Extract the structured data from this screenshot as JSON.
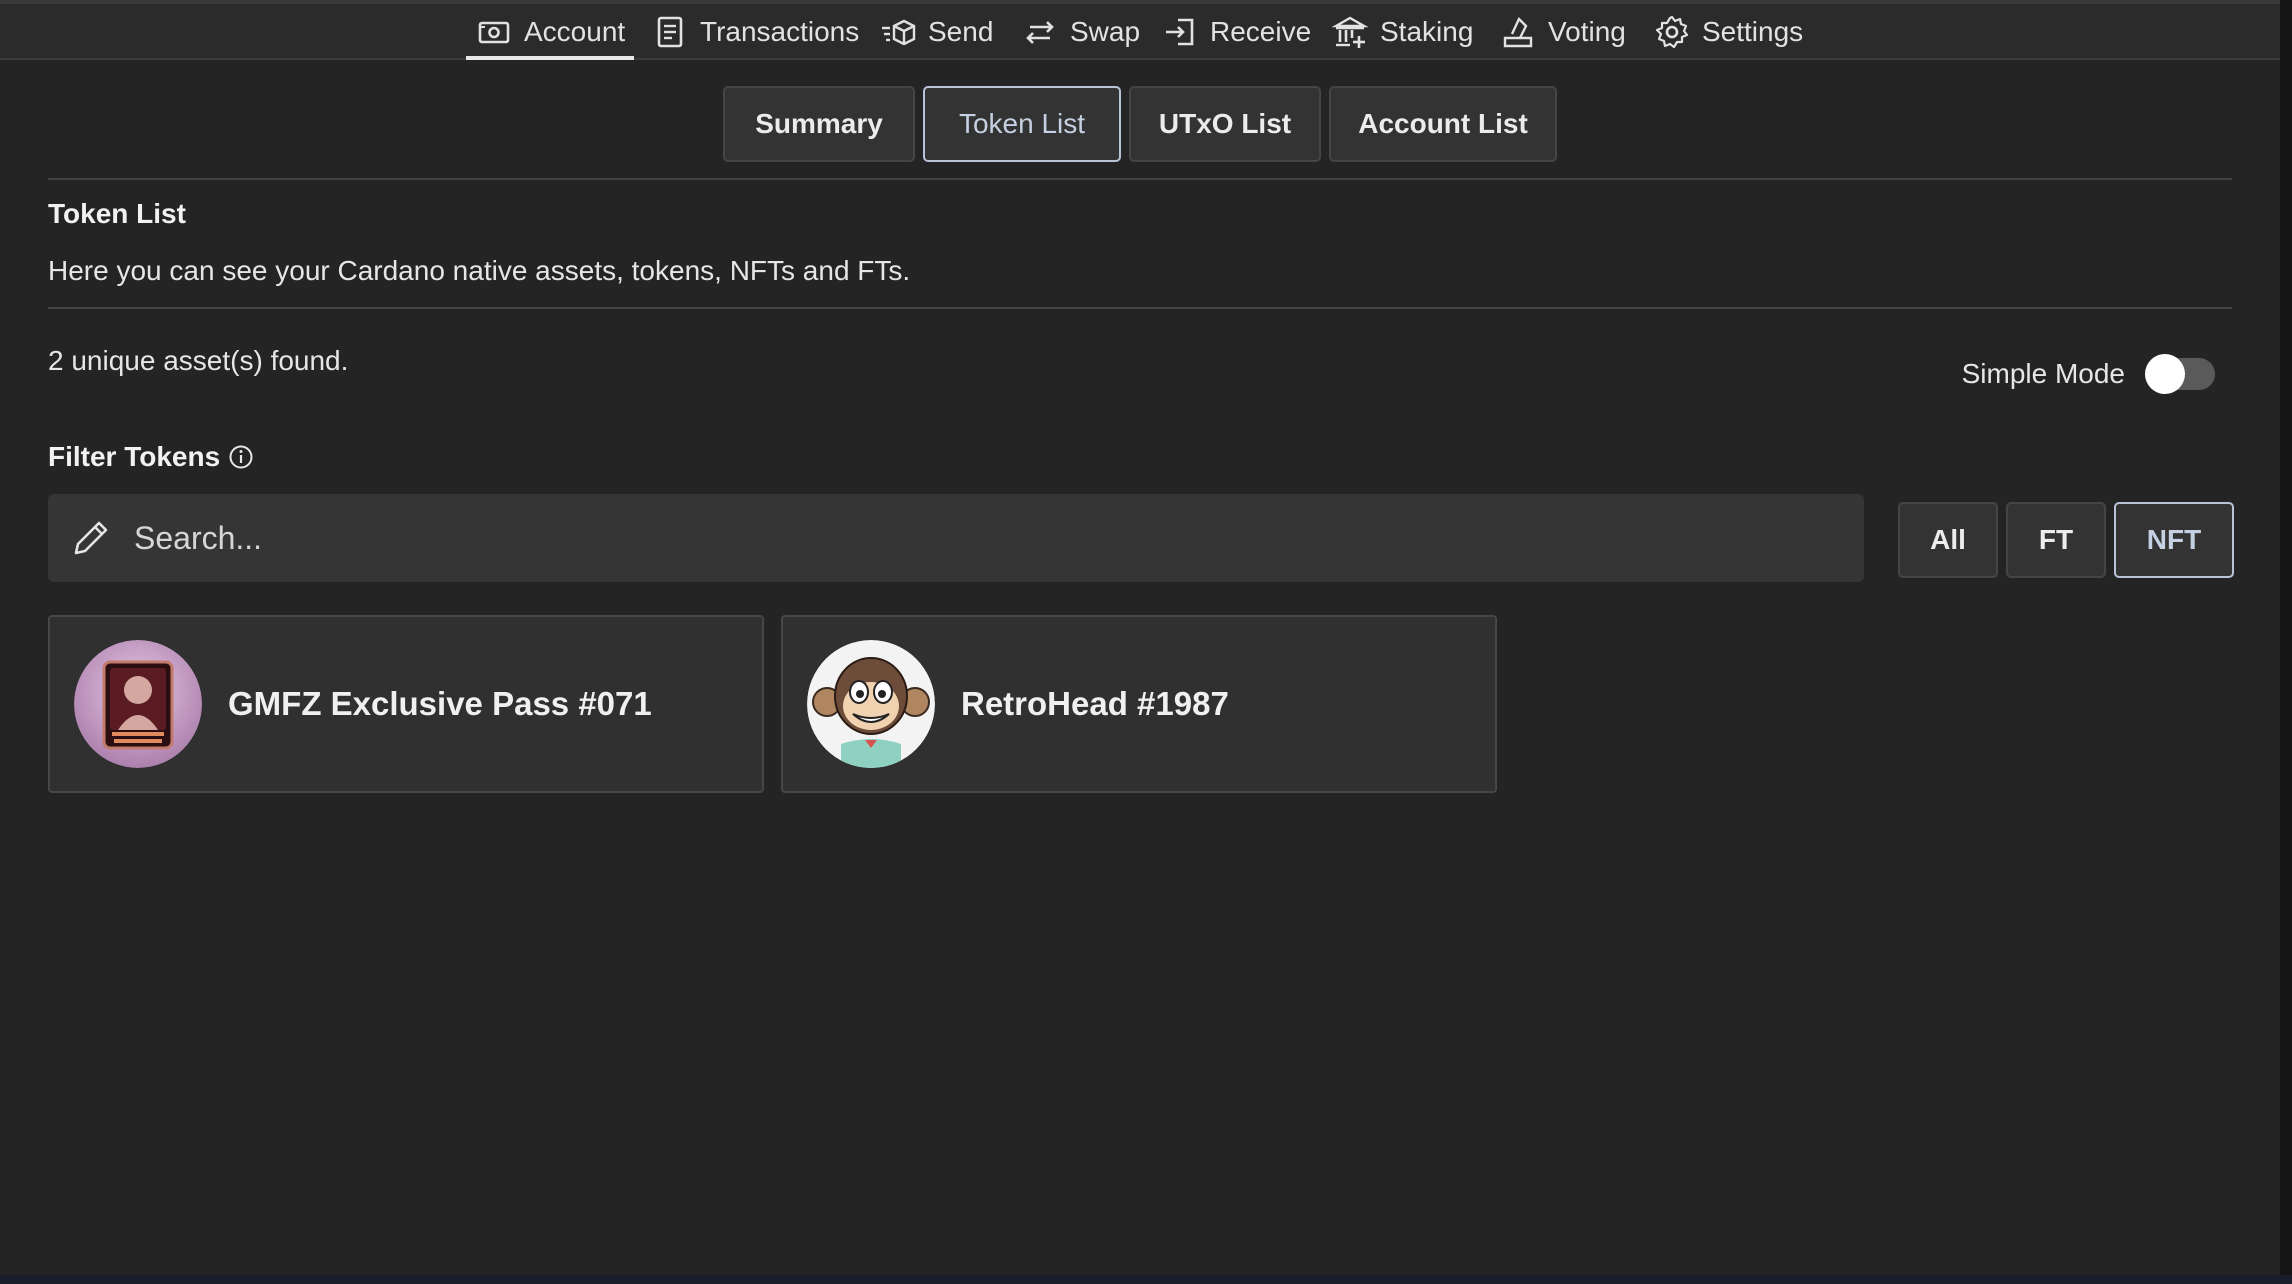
{
  "nav": {
    "items": [
      {
        "label": "Account",
        "icon": "wallet-icon"
      },
      {
        "label": "Transactions",
        "icon": "document-list-icon"
      },
      {
        "label": "Send",
        "icon": "send-box-icon"
      },
      {
        "label": "Swap",
        "icon": "swap-arrows-icon"
      },
      {
        "label": "Receive",
        "icon": "receive-login-icon"
      },
      {
        "label": "Staking",
        "icon": "bank-plus-icon"
      },
      {
        "label": "Voting",
        "icon": "ballot-box-icon"
      },
      {
        "label": "Settings",
        "icon": "gear-icon"
      }
    ],
    "active": "Account"
  },
  "subtabs": {
    "items": [
      "Summary",
      "Token List",
      "UTxO List",
      "Account List"
    ],
    "active": "Token List"
  },
  "section": {
    "title": "Token List",
    "description": "Here you can see your Cardano native assets, tokens, NFTs and FTs."
  },
  "assets": {
    "found_text": "2 unique asset(s) found.",
    "simple_mode_label": "Simple Mode",
    "simple_mode_on": false
  },
  "filter": {
    "label": "Filter Tokens",
    "search_placeholder": "Search...",
    "search_value": "",
    "buttons": [
      "All",
      "FT",
      "NFT"
    ],
    "active": "NFT"
  },
  "tokens": [
    {
      "name": "GMFZ Exclusive Pass #071",
      "image": "pass-card-thumbnail"
    },
    {
      "name": "RetroHead #1987",
      "image": "cartoon-monkey-thumbnail"
    }
  ],
  "colors": {
    "background": "#242424",
    "nav_background": "#2b2b2b",
    "active_accent": "#b7c3d6"
  }
}
